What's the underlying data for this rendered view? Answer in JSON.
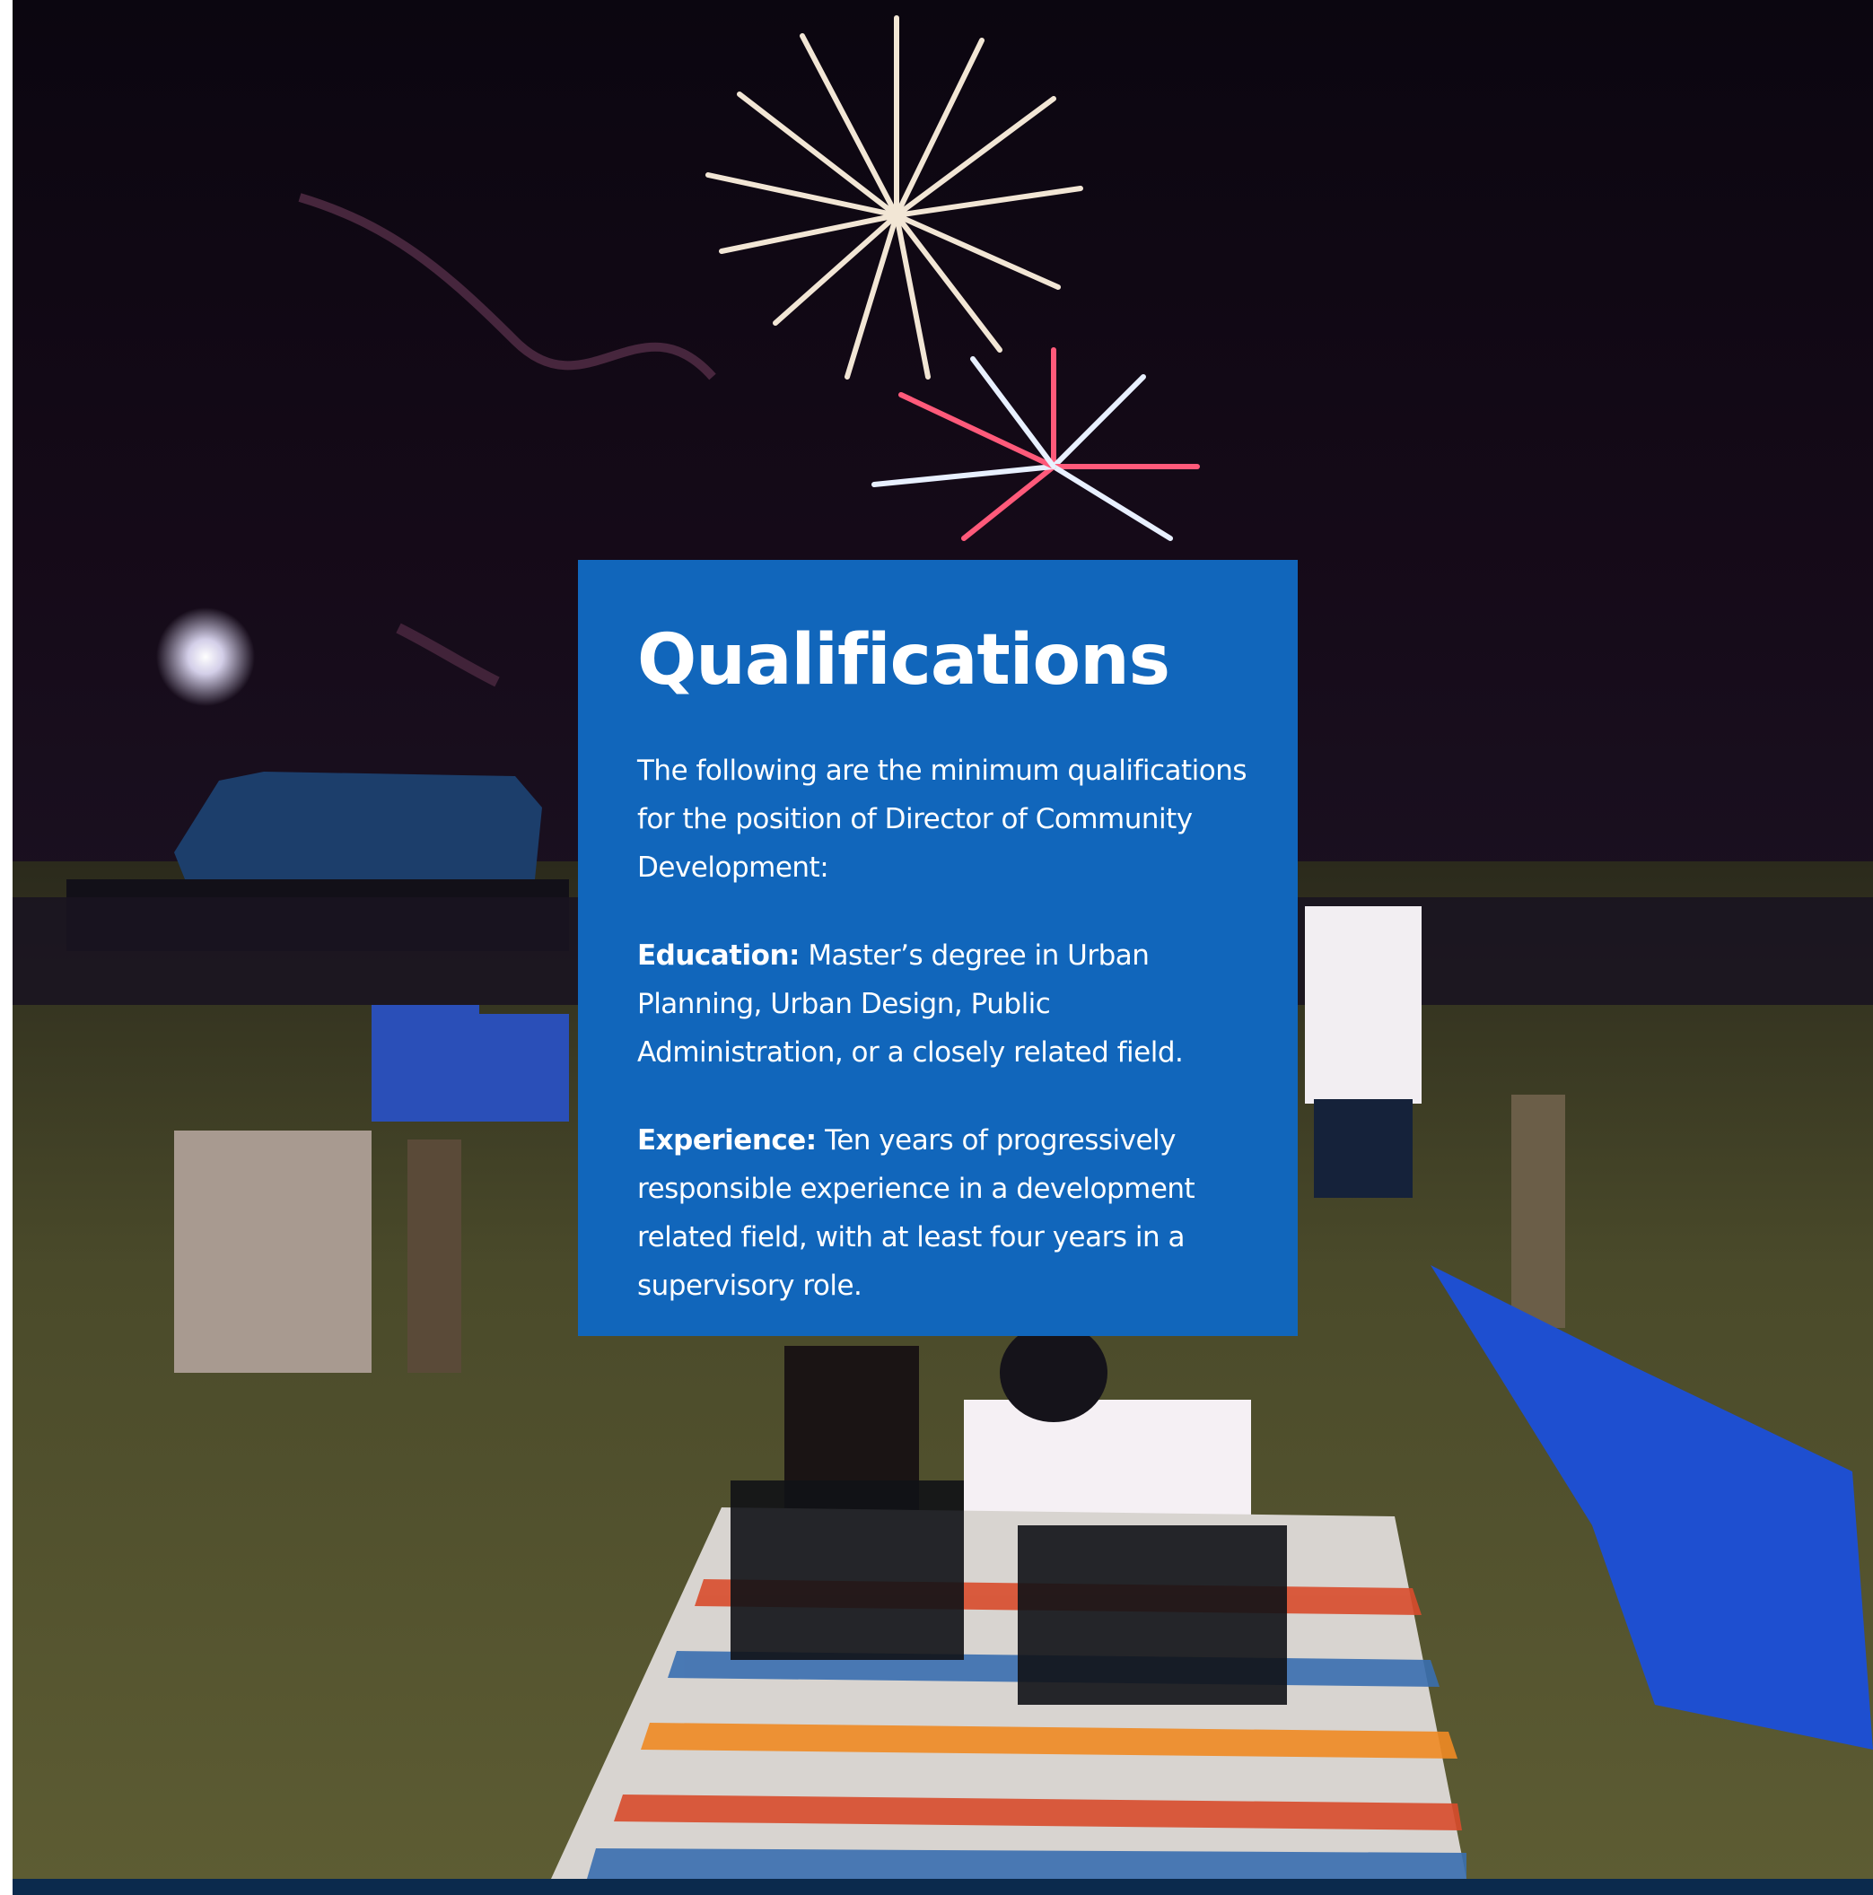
{
  "title": "Qualifications",
  "intro": "The following are the minimum qualifications for the position of Director of Community Development:",
  "education": {
    "label": "Education:",
    "text": "Master’s degree in Urban Planning, Urban Design, Public Administration, or a closely related field."
  },
  "experience": {
    "label": "Experience:",
    "text": "Ten years of progressively responsible experience in a development related field, with at least four years in a supervisory role."
  },
  "colors": {
    "card": "#1166bb",
    "text": "#ffffff",
    "bottom_bar": "#0b2a4d"
  }
}
